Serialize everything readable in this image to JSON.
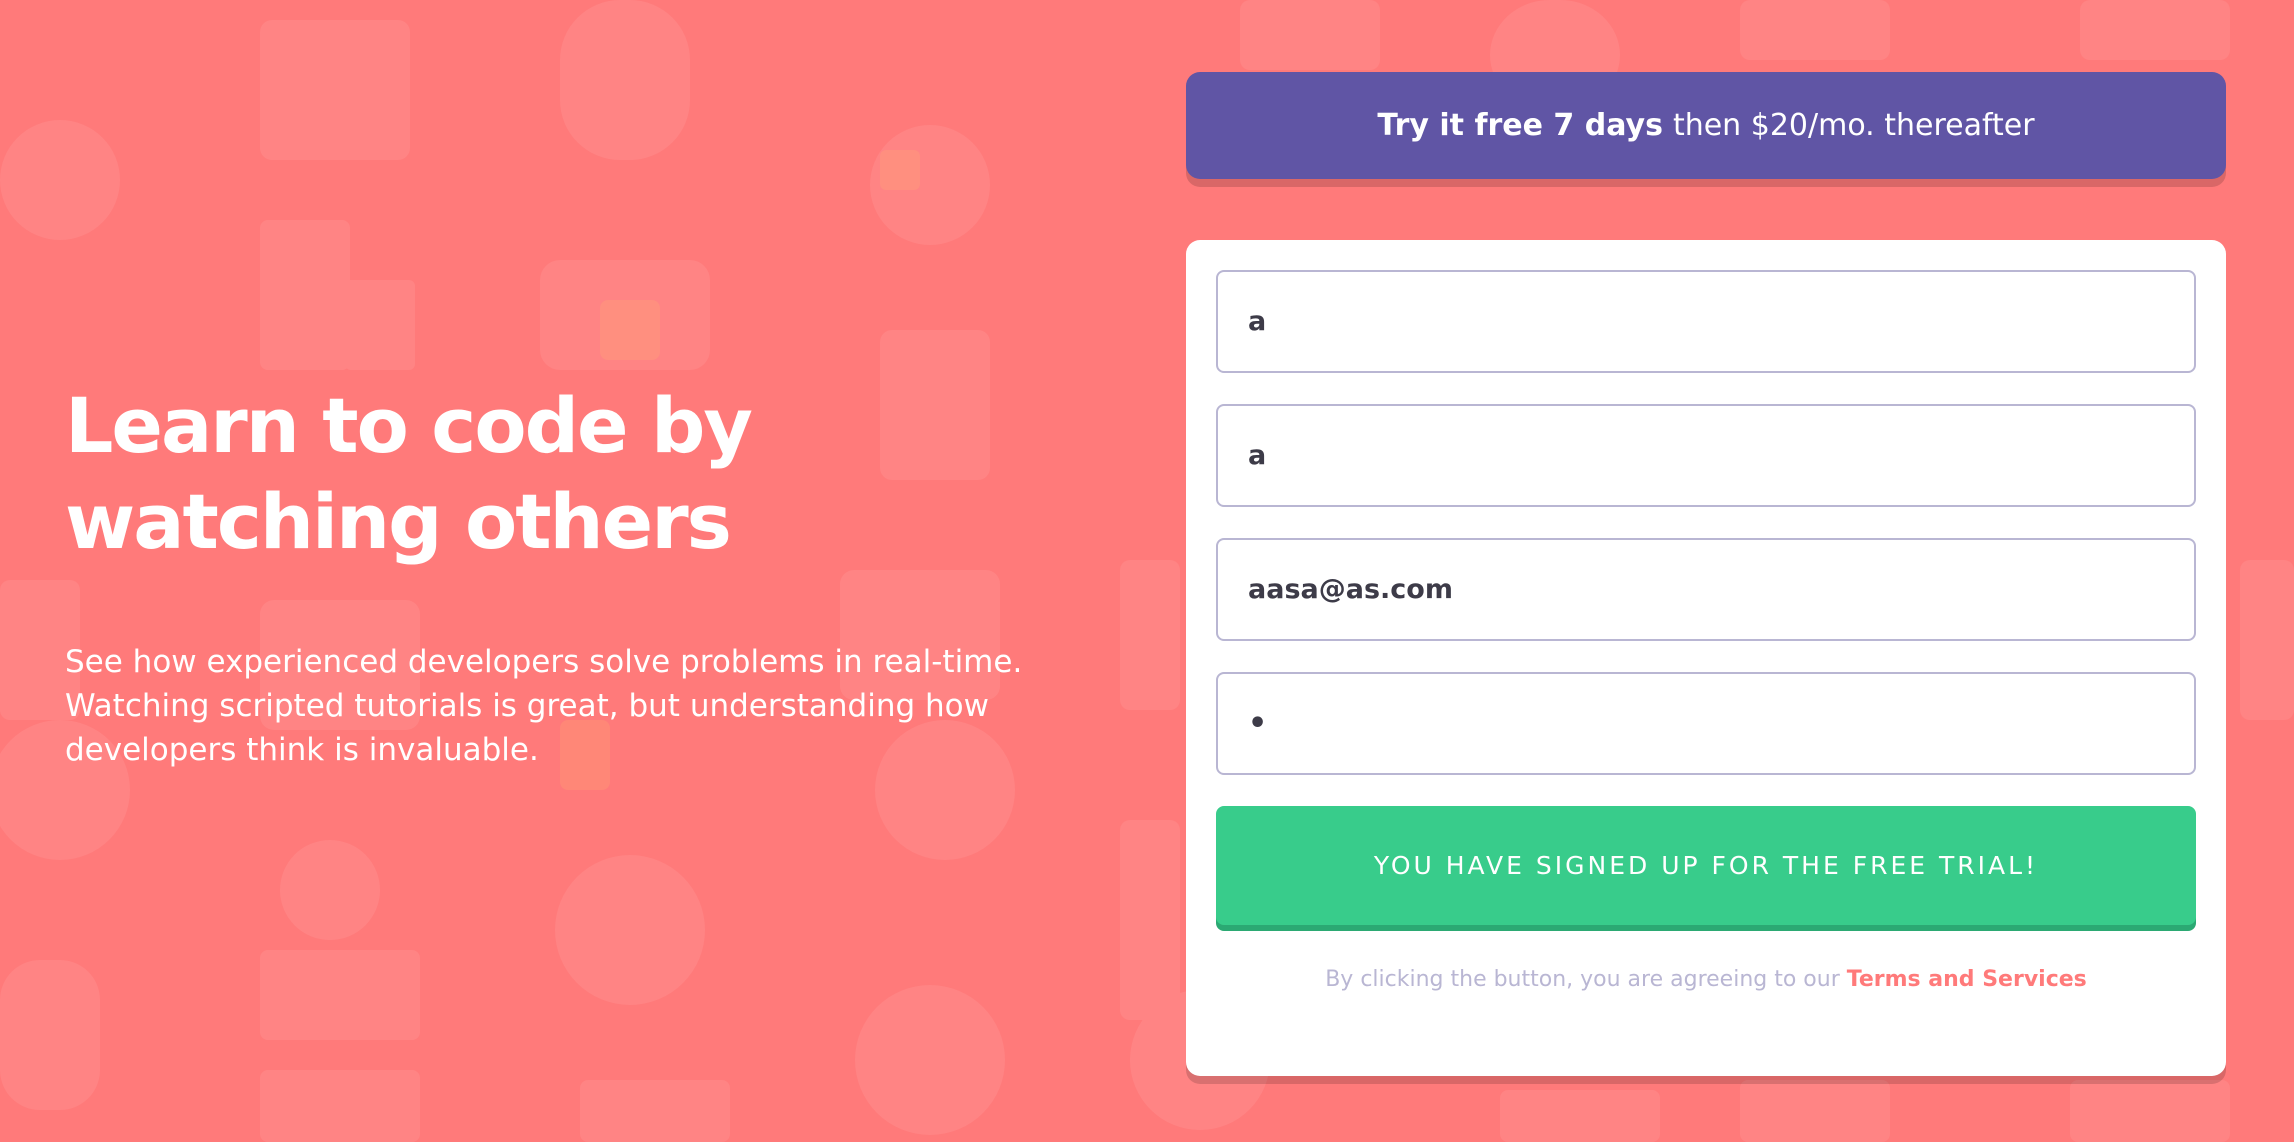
{
  "hero": {
    "title_line1": "Learn to code by",
    "title_line2": "watching others",
    "description": "See how experienced developers solve problems in real-time. Watching scripted tutorials is great, but understanding how developers think is invaluable."
  },
  "banner": {
    "bold_text": "Try it free 7 days",
    "rest_text": "then $20/mo. thereafter"
  },
  "form": {
    "first_name_value": "a",
    "last_name_value": "a",
    "email_value": "aasa@as.com",
    "password_value": "•",
    "submit_label": "YOU HAVE SIGNED UP FOR THE FREE TRIAL!",
    "terms_prefix": "By clicking the button, you are agreeing to our",
    "terms_link": "Terms and Services"
  },
  "colors": {
    "background": "#FF7A7A",
    "banner": "#6055A5",
    "button": "#38CC8B",
    "field_border": "#B9B6D3",
    "text_dark": "#3D3B48"
  }
}
